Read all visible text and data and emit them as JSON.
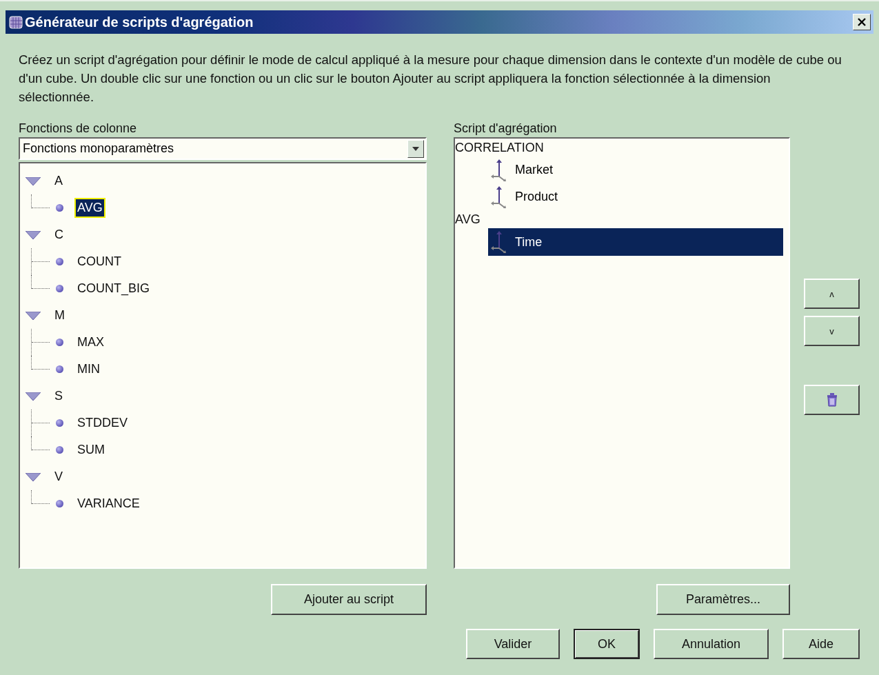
{
  "window": {
    "title": "Générateur de scripts d'agrégation"
  },
  "description": "Créez un script d'agrégation pour définir le mode de calcul appliqué à la mesure pour chaque dimension dans le contexte d'un modèle de cube ou d'un cube. Un double clic sur une fonction ou un clic sur le bouton Ajouter au script appliquera la fonction sélectionnée à la dimension sélectionnée.",
  "functions": {
    "label": "Fonctions de colonne",
    "dropdown": {
      "value": "Fonctions monoparamètres"
    },
    "tree": [
      {
        "label": "A",
        "expanded": true,
        "children": [
          {
            "label": "AVG",
            "selected": true
          }
        ]
      },
      {
        "label": "C",
        "expanded": true,
        "children": [
          {
            "label": "COUNT",
            "selected": false
          },
          {
            "label": "COUNT_BIG",
            "selected": false
          }
        ]
      },
      {
        "label": "M",
        "expanded": true,
        "children": [
          {
            "label": "MAX",
            "selected": false
          },
          {
            "label": "MIN",
            "selected": false
          }
        ]
      },
      {
        "label": "S",
        "expanded": true,
        "children": [
          {
            "label": "STDDEV",
            "selected": false
          },
          {
            "label": "SUM",
            "selected": false
          }
        ]
      },
      {
        "label": "V",
        "expanded": true,
        "children": [
          {
            "label": "VARIANCE",
            "selected": false
          }
        ]
      }
    ],
    "add_button": "Ajouter au script"
  },
  "script": {
    "label": "Script d'agrégation",
    "tree": [
      {
        "label": "CORRELATION",
        "children": [
          {
            "label": "Market",
            "selected": false
          },
          {
            "label": "Product",
            "selected": false
          }
        ]
      },
      {
        "label": "AVG",
        "children": [
          {
            "label": "Time",
            "selected": true
          }
        ]
      }
    ],
    "parameters_button": "Paramètres..."
  },
  "side_buttons": [
    {
      "kind": "up",
      "label": "ʌ"
    },
    {
      "kind": "down",
      "label": "v"
    },
    {
      "kind": "delete"
    }
  ],
  "footer_buttons": [
    {
      "label": "Valider",
      "default": false
    },
    {
      "label": "OK",
      "default": true
    },
    {
      "label": "Annulation",
      "default": false
    },
    {
      "label": "Aide",
      "default": false
    }
  ]
}
